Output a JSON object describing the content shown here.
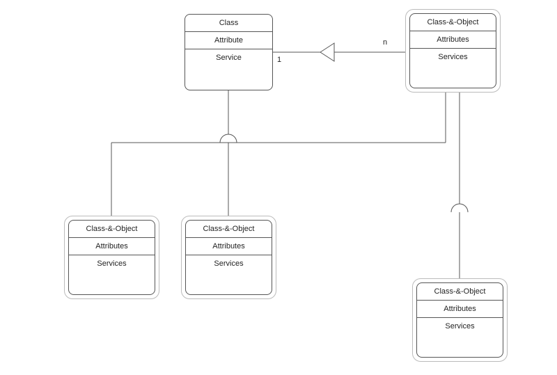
{
  "diagram": {
    "class_box": {
      "title": "Class",
      "attr": "Attribute",
      "serv": "Service"
    },
    "top_right": {
      "title": "Class-&-Object",
      "attr": "Attributes",
      "serv": "Services"
    },
    "child_left": {
      "title": "Class-&-Object",
      "attr": "Attributes",
      "serv": "Services"
    },
    "child_mid": {
      "title": "Class-&-Object",
      "attr": "Attributes",
      "serv": "Services"
    },
    "child_bottom_right": {
      "title": "Class-&-Object",
      "attr": "Attributes",
      "serv": "Services"
    },
    "relation": {
      "left_mult": "1",
      "right_mult": "n"
    }
  }
}
